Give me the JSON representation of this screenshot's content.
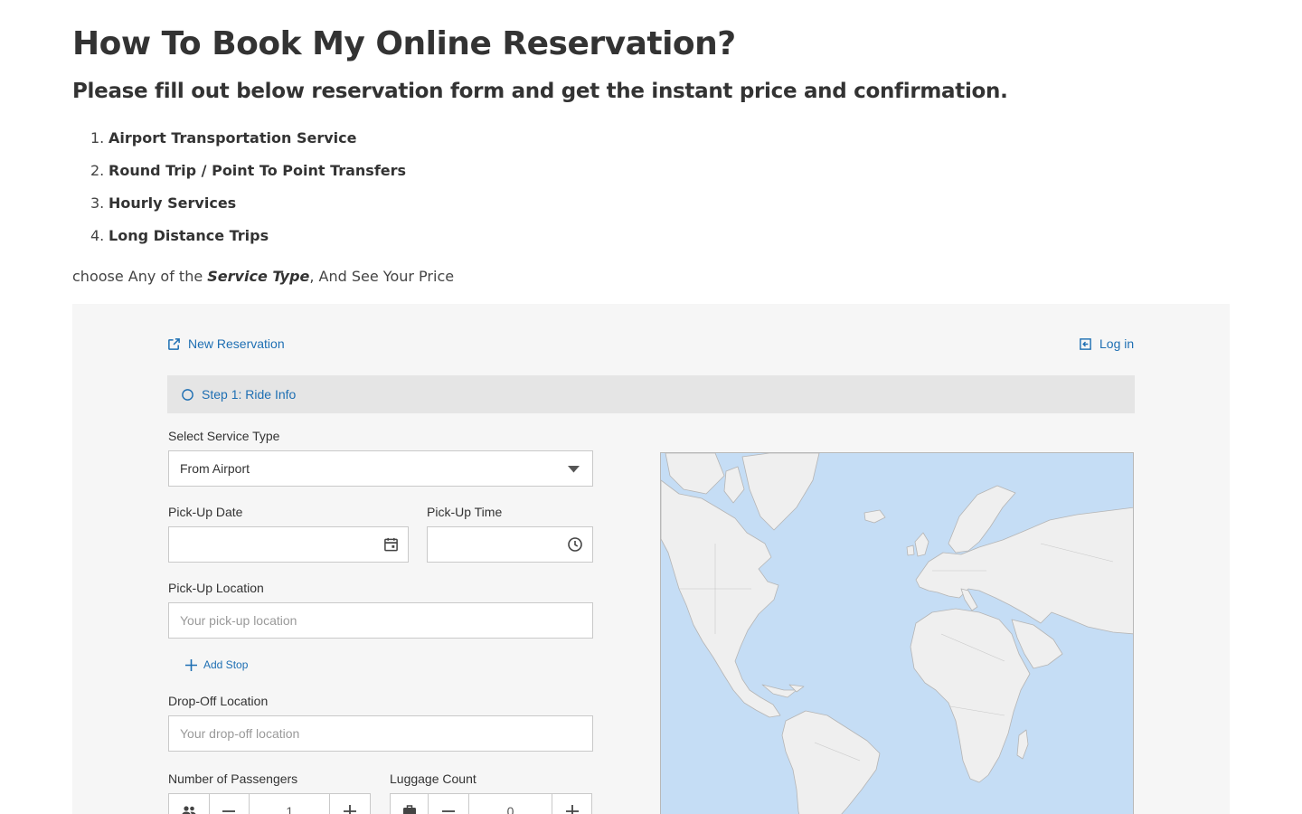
{
  "header": {
    "title": "How To Book My Online Reservation?",
    "subtitle": "Please fill out below reservation form and get the instant price and confirmation."
  },
  "services": [
    {
      "num": "1.",
      "label": "Airport Transportation Service"
    },
    {
      "num": "2.",
      "label": "Round Trip / Point To Point Transfers"
    },
    {
      "num": "3.",
      "label": "Hourly Services"
    },
    {
      "num": "4.",
      "label": "Long Distance Trips"
    }
  ],
  "choose": {
    "prefix": "choose Any of the ",
    "emphasis": "Service Type",
    "suffix": ", And See Your Price"
  },
  "widget": {
    "new_reservation": "New Reservation",
    "login": "Log in",
    "step": "Step 1: Ride Info",
    "service_type": {
      "label": "Select Service Type",
      "value": "From Airport"
    },
    "pickup_date": {
      "label": "Pick-Up Date",
      "value": ""
    },
    "pickup_time": {
      "label": "Pick-Up Time",
      "value": ""
    },
    "pickup_location": {
      "label": "Pick-Up Location",
      "placeholder": "Your pick-up location"
    },
    "add_stop": "Add Stop",
    "dropoff_location": {
      "label": "Drop-Off Location",
      "placeholder": "Your drop-off location"
    },
    "passengers": {
      "label": "Number of Passengers",
      "value": "1"
    },
    "luggage": {
      "label": "Luggage Count",
      "value": "0"
    }
  },
  "colors": {
    "link": "#1e6fb3",
    "map_water": "#c5ddf5",
    "map_land": "#efefef",
    "widget_bg": "#f6f6f6",
    "step_bg": "#e5e5e5"
  }
}
